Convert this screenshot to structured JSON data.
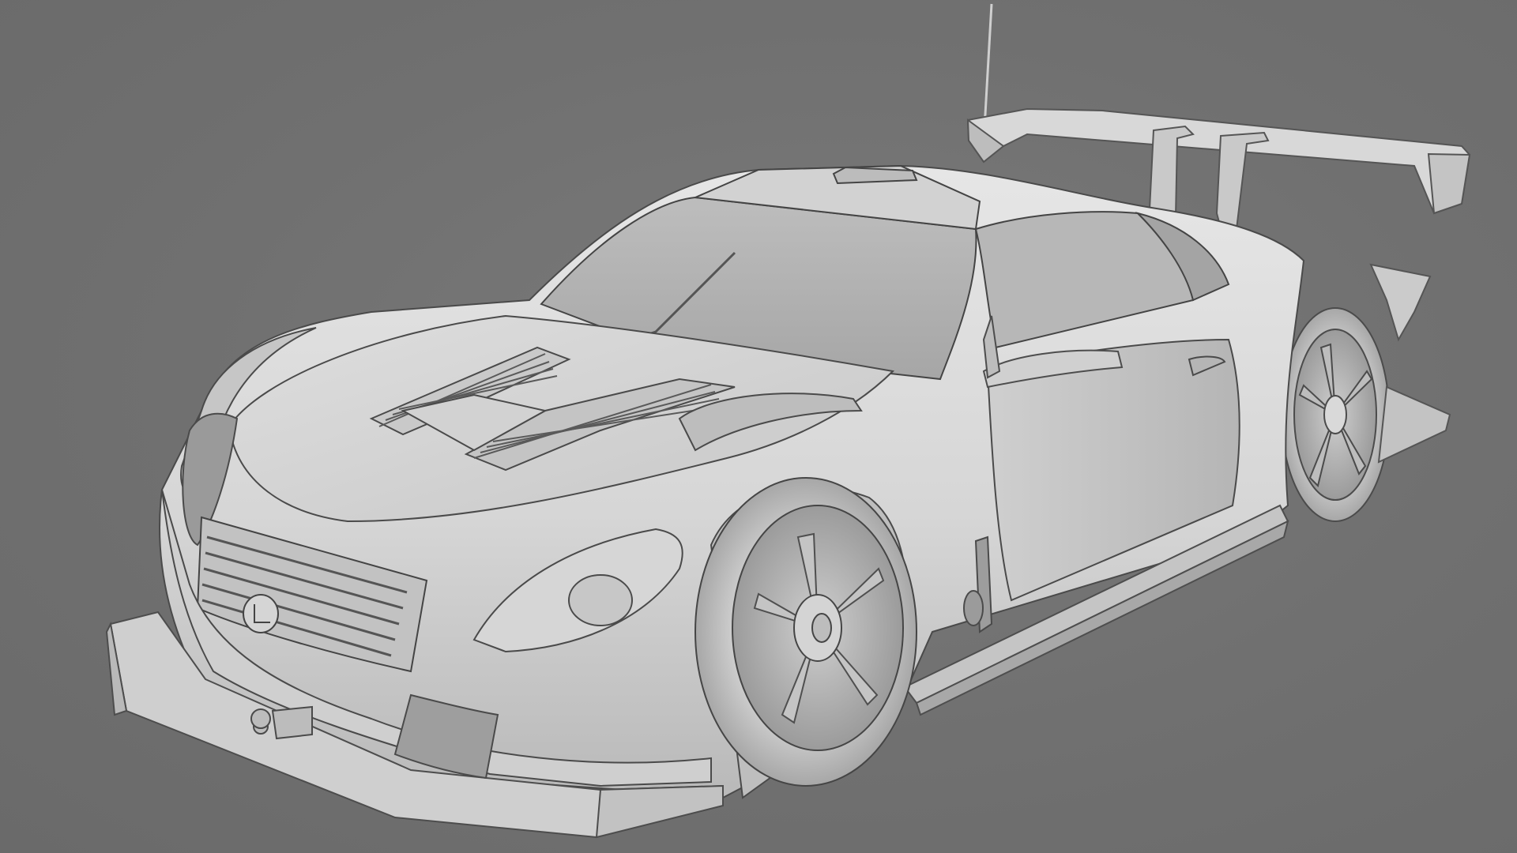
{
  "scene": {
    "description_free": true,
    "colors": {
      "background": "#6f6f6f",
      "body": "#dcdcdc",
      "body_shadow": "#a9a9a9",
      "line": "#4a4a4a",
      "tire": "#cfcfcf"
    },
    "icons": [
      "car-render",
      "emblem-icon"
    ]
  }
}
